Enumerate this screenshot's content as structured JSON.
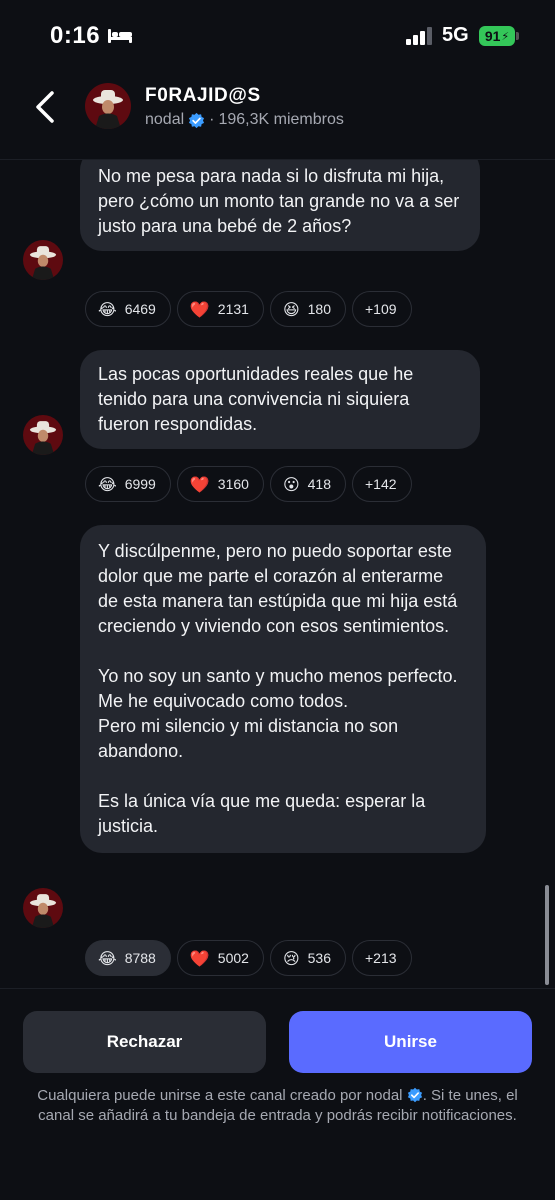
{
  "status_bar": {
    "time": "0:16",
    "network": "5G",
    "battery": "91"
  },
  "header": {
    "channel_name": "F0RAJID@S",
    "owner": "nodal",
    "members": "196,3K miembros"
  },
  "messages": [
    {
      "paragraphs": [
        "No me pesa para nada si lo disfruta mi hija, pero ¿cómo un monto tan grande no va a ser justo para una bebé de 2 años?"
      ],
      "reactions": [
        {
          "emoji": "😂",
          "icon": "laughing-emoji",
          "count": "6469"
        },
        {
          "emoji": "❤️",
          "icon": "heart-emoji",
          "count": "2131"
        },
        {
          "emoji": "😆",
          "icon": "grinning-squint-emoji",
          "count": "180"
        },
        {
          "emoji": "",
          "icon": "",
          "count": "+109"
        }
      ]
    },
    {
      "paragraphs": [
        "Las pocas oportunidades reales que he tenido para una convivencia ni siquiera fueron respondidas."
      ],
      "reactions": [
        {
          "emoji": "😂",
          "icon": "laughing-emoji",
          "count": "6999"
        },
        {
          "emoji": "❤️",
          "icon": "heart-emoji",
          "count": "3160"
        },
        {
          "emoji": "😮",
          "icon": "surprised-emoji",
          "count": "418"
        },
        {
          "emoji": "",
          "icon": "",
          "count": "+142"
        }
      ]
    },
    {
      "paragraphs": [
        "Y discúlpenme, pero no puedo soportar este dolor que me parte el corazón al enterarme de esta manera tan estúpida que mi hija está creciendo y viviendo con esos sentimientos.",
        "Yo no soy un santo y mucho menos perfecto.",
        "Me he equivocado como todos.",
        "Pero mi silencio y mi distancia no son abandono.",
        "Es la única vía que me queda: esperar la justicia."
      ],
      "reactions": [
        {
          "emoji": "😂",
          "icon": "laughing-emoji",
          "count": "8788"
        },
        {
          "emoji": "❤️",
          "icon": "heart-emoji",
          "count": "5002"
        },
        {
          "emoji": "😢",
          "icon": "crying-emoji",
          "count": "536"
        },
        {
          "emoji": "",
          "icon": "",
          "count": "+213"
        }
      ]
    }
  ],
  "footer": {
    "reject_label": "Rechazar",
    "join_label": "Unirse",
    "note_before": "Cualquiera puede unirse a este canal creado por nodal",
    "note_after": "Si te unes, el canal se añadirá a tu bandeja de entrada y podrás recibir notificaciones."
  },
  "colors": {
    "background": "#0d0f14",
    "bubble": "#24272f",
    "join_button": "#5a6bff",
    "reject_button": "#2a2d35",
    "verified": "#3b9cff",
    "battery": "#34c759"
  }
}
